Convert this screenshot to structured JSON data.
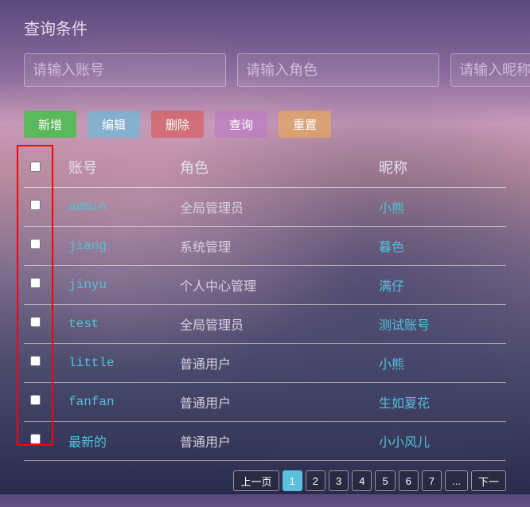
{
  "query": {
    "title": "查询条件",
    "account_ph": "请输入账号",
    "role_ph": "请输入角色",
    "nick_ph": "请输入昵称"
  },
  "buttons": {
    "add": "新增",
    "edit": "编辑",
    "del": "删除",
    "query": "查询",
    "reset": "重置"
  },
  "table": {
    "headers": {
      "account": "账号",
      "role": "角色",
      "nick": "昵称"
    },
    "rows": [
      {
        "account": "admin",
        "role": "全局管理员",
        "nick": "小熊"
      },
      {
        "account": "jiang",
        "role": "系统管理",
        "nick": "暮色"
      },
      {
        "account": "jinyu",
        "role": "个人中心管理",
        "nick": "满仔"
      },
      {
        "account": "test",
        "role": "全局管理员",
        "nick": "测试账号"
      },
      {
        "account": "little",
        "role": "普通用户",
        "nick": "小熊"
      },
      {
        "account": "fanfan",
        "role": "普通用户",
        "nick": "生如夏花"
      },
      {
        "account": "最新的",
        "role": "普通用户",
        "nick": "小小风儿"
      }
    ]
  },
  "pager": {
    "prev": "上一页",
    "next": "下一",
    "pages": [
      "1",
      "2",
      "3",
      "4",
      "5",
      "6",
      "7",
      "..."
    ],
    "active": 1
  }
}
